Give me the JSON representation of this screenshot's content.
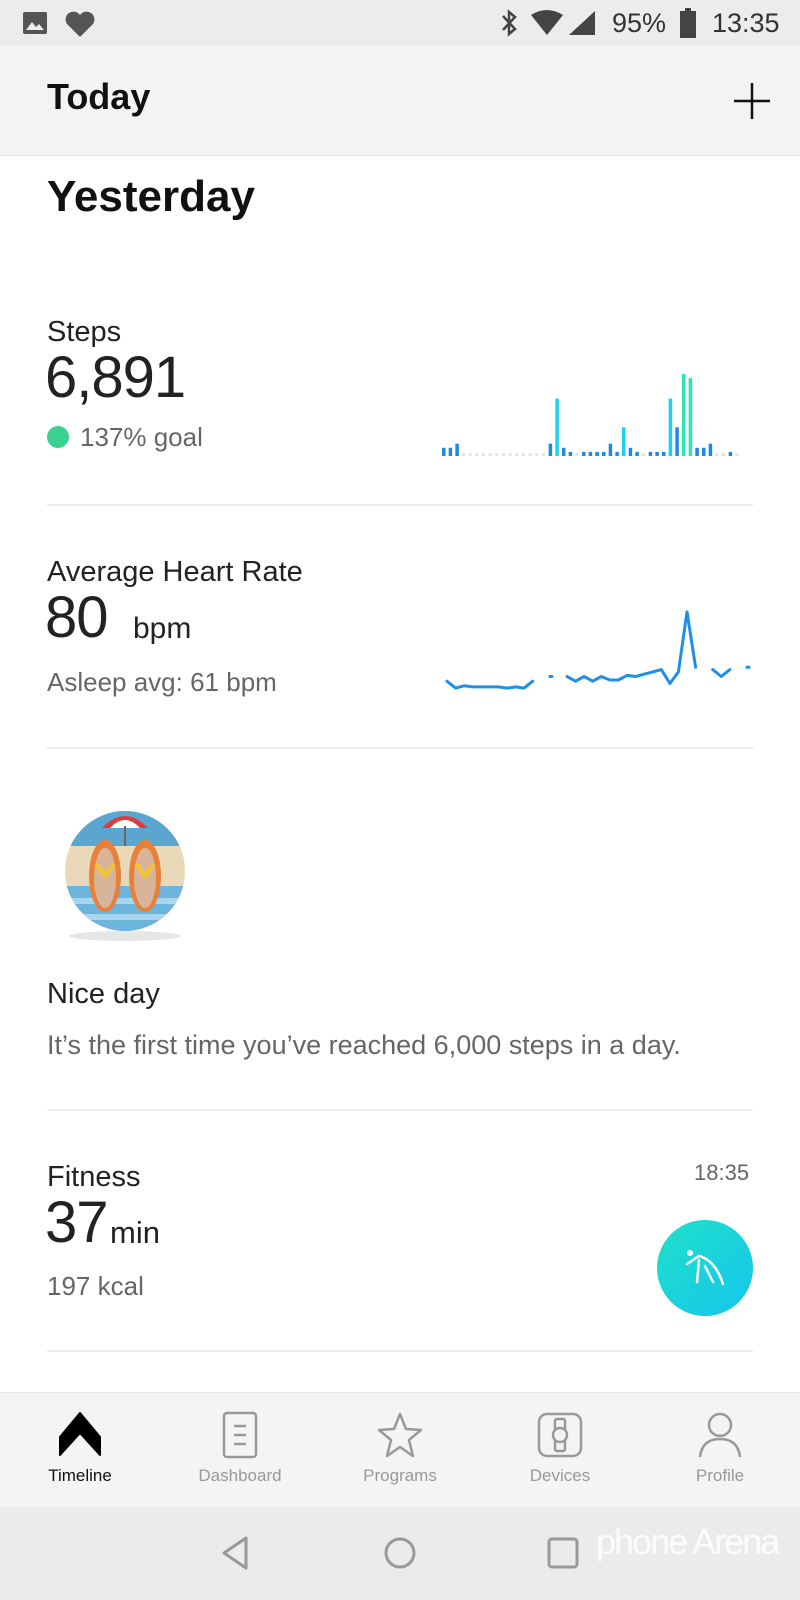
{
  "status_bar": {
    "battery": "95%",
    "time": "13:35",
    "icons": [
      "image-icon",
      "heart-icon",
      "bluetooth-icon",
      "wifi-icon",
      "signal-icon",
      "battery-icon"
    ]
  },
  "header": {
    "title": "Today",
    "add_icon": "plus-icon"
  },
  "section_title": "Yesterday",
  "steps": {
    "label": "Steps",
    "value": "6,891",
    "goal": "137% goal",
    "goal_color": "#3ad08f",
    "chart_data": {
      "type": "bar",
      "values": [
        2,
        2,
        3,
        0,
        0,
        0,
        0,
        0,
        0,
        0,
        0,
        0,
        0,
        0,
        0,
        0,
        3,
        14,
        2,
        1,
        0,
        1,
        1,
        1,
        1,
        3,
        1,
        7,
        2,
        1,
        0,
        1,
        1,
        1,
        14,
        7,
        20,
        19,
        2,
        2,
        3,
        0,
        0,
        1,
        0
      ],
      "colors": {
        "low": "#1e88e5",
        "mid": "#1ed0f0",
        "high": "#2ee6b0",
        "empty": "#e3e3e3"
      }
    }
  },
  "heart": {
    "label": "Average Heart Rate",
    "value": "80",
    "unit": "bpm",
    "asleep": "Asleep avg: 61 bpm",
    "chart_data": {
      "type": "line",
      "color": "#1e90e8",
      "values": [
        62,
        59,
        60,
        59.5,
        59.5,
        59.5,
        59.5,
        59,
        59.5,
        59,
        62,
        null,
        64,
        null,
        64,
        62,
        64,
        62,
        64,
        62.5,
        62.5,
        64.5,
        64,
        65,
        66,
        67,
        61,
        66,
        92,
        68,
        null,
        67,
        64,
        67,
        null,
        68
      ]
    }
  },
  "achievement": {
    "title": "Nice day",
    "message": "It’s the first time you’ve reached 6,000 steps in a day."
  },
  "fitness": {
    "label": "Fitness",
    "value": "37",
    "unit": "min",
    "kcal": "197 kcal",
    "time": "18:35",
    "icon": "activity-icon",
    "color": "#1fd6d6"
  },
  "bottom_nav": [
    {
      "label": "Timeline",
      "active": true
    },
    {
      "label": "Dashboard"
    },
    {
      "label": "Programs"
    },
    {
      "label": "Devices"
    },
    {
      "label": "Profile"
    }
  ],
  "watermark": "phone Arena"
}
